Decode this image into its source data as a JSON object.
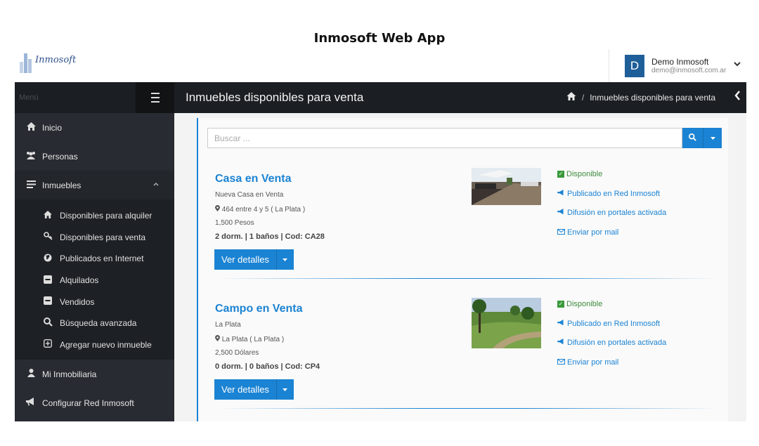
{
  "app_title": "Inmosoft Web App",
  "logo": {
    "text": "Inmosoft"
  },
  "user": {
    "avatar_letter": "D",
    "name": "Demo Inmosoft",
    "email": "demo@inmosoft.com.ar"
  },
  "sidebar": {
    "menu_label": "Menú",
    "items": [
      {
        "label": "Inicio",
        "icon": "home-icon"
      },
      {
        "label": "Personas",
        "icon": "users-icon"
      },
      {
        "label": "Inmuebles",
        "icon": "list-icon",
        "open": true
      },
      {
        "label": "Mi Inmobiliaria",
        "icon": "user-icon"
      },
      {
        "label": "Configurar Red Inmosoft",
        "icon": "megaphone-icon"
      }
    ],
    "subitems": [
      {
        "label": "Disponibles para alquiler",
        "icon": "home-icon"
      },
      {
        "label": "Disponibles para venta",
        "icon": "key-icon"
      },
      {
        "label": "Publicados en Internet",
        "icon": "globe-icon"
      },
      {
        "label": "Alquilados",
        "icon": "minus-square-icon"
      },
      {
        "label": "Vendidos",
        "icon": "minus-square-icon"
      },
      {
        "label": "Búsqueda avanzada",
        "icon": "search-icon"
      },
      {
        "label": "Agregar nuevo inmueble",
        "icon": "plus-square-icon"
      }
    ]
  },
  "header": {
    "title": "Inmuebles disponibles para venta",
    "breadcrumb": "Inmuebles disponibles para venta"
  },
  "search": {
    "placeholder": "Buscar ..."
  },
  "listings": [
    {
      "title": "Casa en Venta",
      "description": "Nueva Casa en Venta",
      "address": "464 entre 4 y 5 ( La Plata )",
      "price": "1,500 Pesos",
      "specs": "2 dorm. | 1 baños | Cod: CA28",
      "details_label": "Ver detalles",
      "status": "Disponible",
      "red": "Publicado en Red Inmosoft",
      "portales": "Difusión en portales activada",
      "mail": "Enviar por mail"
    },
    {
      "title": "Campo en Venta",
      "description": "La Plata",
      "address": "La Plata ( La Plata )",
      "price": "2,500 Dólares",
      "specs": "0 dorm. | 0 baños | Cod: CP4",
      "details_label": "Ver detalles",
      "status": "Disponible",
      "red": "Publicado en Red Inmosoft",
      "portales": "Difusión en portales activada",
      "mail": "Enviar por mail"
    }
  ],
  "colors": {
    "accent": "#1b83d3",
    "sidebar": "#282b31",
    "header": "#1b1e22",
    "success": "#3a9a3a"
  }
}
